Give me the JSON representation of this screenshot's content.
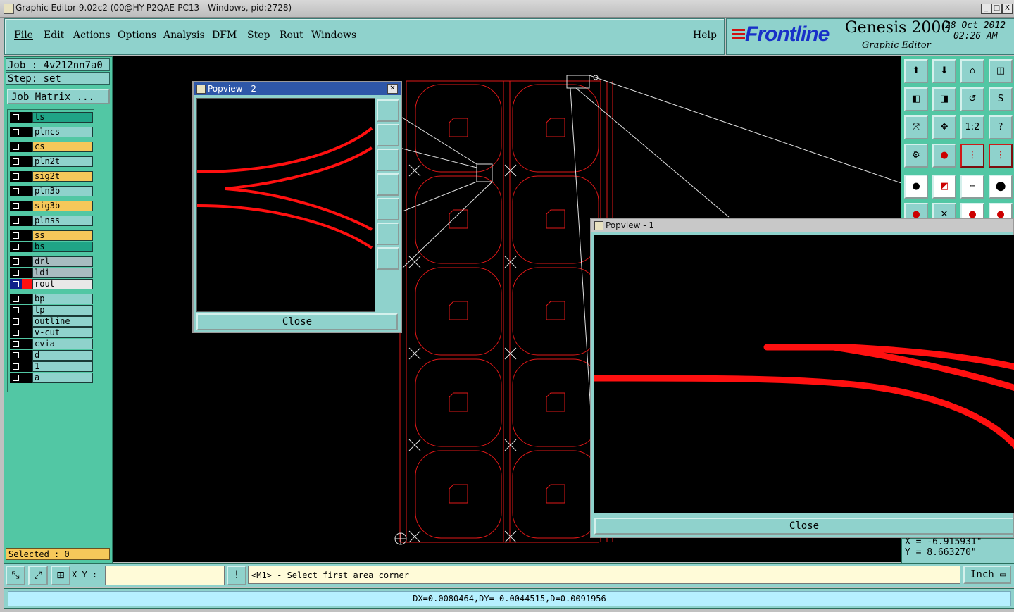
{
  "window": {
    "title": "Graphic Editor 9.02c2 (00@HY-P2QAE-PC13 - Windows, pid:2728)",
    "minimize": "_",
    "maximize": "□",
    "close": "X"
  },
  "menu": {
    "items": [
      "File",
      "Edit",
      "Actions",
      "Options",
      "Analysis",
      "DFM",
      "Step",
      "Rout",
      "Windows"
    ],
    "help": "Help"
  },
  "brand": {
    "logo": "Frontline",
    "product": "Genesis 2000",
    "subtitle": "Graphic Editor",
    "date": "28 Oct 2012",
    "time": "02:26 AM"
  },
  "job": {
    "job_label": "Job : 4v212nn7a0",
    "step_label": "Step: set",
    "matrix_button": "Job Matrix ..."
  },
  "layers": [
    {
      "name": "ts",
      "bg": "#1fa486",
      "swatch": "#000000"
    },
    {
      "name": "plncs",
      "bg": "#8fd2cc",
      "swatch": "#000000"
    },
    {
      "name": "cs",
      "bg": "#f6c85a",
      "swatch": "#000000"
    },
    {
      "name": "pln2t",
      "bg": "#8fd2cc",
      "swatch": "#000000"
    },
    {
      "name": "sig2t",
      "bg": "#f6c85a",
      "swatch": "#000000"
    },
    {
      "name": "pln3b",
      "bg": "#8fd2cc",
      "swatch": "#000000"
    },
    {
      "name": "sig3b",
      "bg": "#f6c85a",
      "swatch": "#000000"
    },
    {
      "name": "plnss",
      "bg": "#8fd2cc",
      "swatch": "#000000"
    },
    {
      "name": "ss",
      "bg": "#f6c85a",
      "swatch": "#000000"
    },
    {
      "name": "bs",
      "bg": "#1fa486",
      "swatch": "#000000"
    },
    {
      "name": "drl",
      "bg": "#a8bcc0",
      "swatch": "#000000"
    },
    {
      "name": "ldi",
      "bg": "#a8bcc0",
      "swatch": "#000000"
    },
    {
      "name": "rout",
      "bg": "#e8e8e8",
      "swatch": "#ff1010",
      "active": true
    },
    {
      "name": "bp",
      "bg": "#8fd2cc",
      "swatch": "#000000"
    },
    {
      "name": "tp",
      "bg": "#8fd2cc",
      "swatch": "#000000"
    },
    {
      "name": "outline",
      "bg": "#8fd2cc",
      "swatch": "#000000"
    },
    {
      "name": "v-cut",
      "bg": "#8fd2cc",
      "swatch": "#000000"
    },
    {
      "name": "cvia",
      "bg": "#8fd2cc",
      "swatch": "#000000"
    },
    {
      "name": "d",
      "bg": "#8fd2cc",
      "swatch": "#000000"
    },
    {
      "name": "1",
      "bg": "#8fd2cc",
      "swatch": "#000000"
    },
    {
      "name": "a",
      "bg": "#8fd2cc",
      "swatch": "#000000"
    }
  ],
  "selected_label": "Selected : 0",
  "popview2": {
    "title": "Popview - 2",
    "close_label": "Close"
  },
  "popview1": {
    "title": "Popview - 1",
    "close_label": "Close"
  },
  "toolbar": {
    "icons": [
      "zoom-home-icon",
      "zoom-back-icon",
      "home-view-icon",
      "window-icon",
      "pan-left-icon",
      "pan-right-icon",
      "redraw-icon",
      "snap-icon",
      "fit-screen-icon",
      "zoom-in-icon",
      "scale-1-2-icon",
      "help-icon",
      "measure-tool-icon",
      "pin-icon",
      "layer-top-icon",
      "layer-bottom-icon",
      "pad-select-icon",
      "profile-icon",
      "ruler-icon",
      "dot-icon"
    ],
    "scale_label": "1:2",
    "help_label": "?"
  },
  "coords": {
    "x": "X = -6.915931\"",
    "y": "Y = 8.663270\""
  },
  "command": {
    "xy_label": "X Y :",
    "xy_value": "",
    "message": "<M1> - Select first area corner",
    "units": "Inch"
  },
  "status": {
    "text": "DX=0.0080464,DY=-0.0044515,D=0.0091956"
  }
}
